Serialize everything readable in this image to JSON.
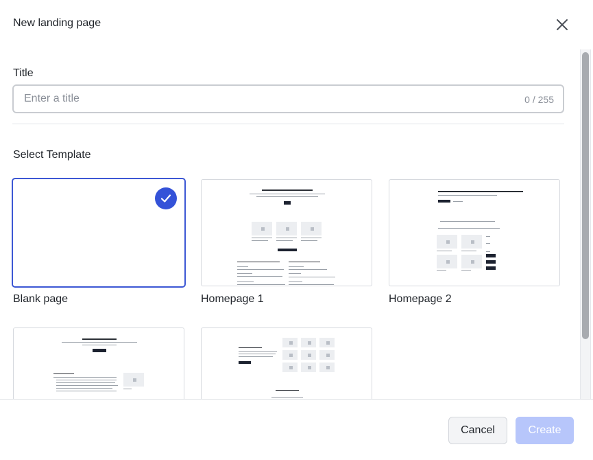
{
  "dialog": {
    "title": "New landing page",
    "close_icon": "close-icon"
  },
  "form": {
    "title_label": "Title",
    "title_value": "",
    "title_placeholder": "Enter a title",
    "title_counter": "0 / 255"
  },
  "templates": {
    "section_label": "Select Template",
    "items": [
      {
        "name": "Blank page",
        "selected": true
      },
      {
        "name": "Homepage 1",
        "selected": false
      },
      {
        "name": "Homepage 2",
        "selected": false
      },
      {
        "name": "",
        "selected": false
      },
      {
        "name": "",
        "selected": false
      }
    ]
  },
  "footer": {
    "cancel_label": "Cancel",
    "create_label": "Create"
  },
  "colors": {
    "accent": "#3452d8",
    "create_disabled": "#b7c6fb"
  }
}
